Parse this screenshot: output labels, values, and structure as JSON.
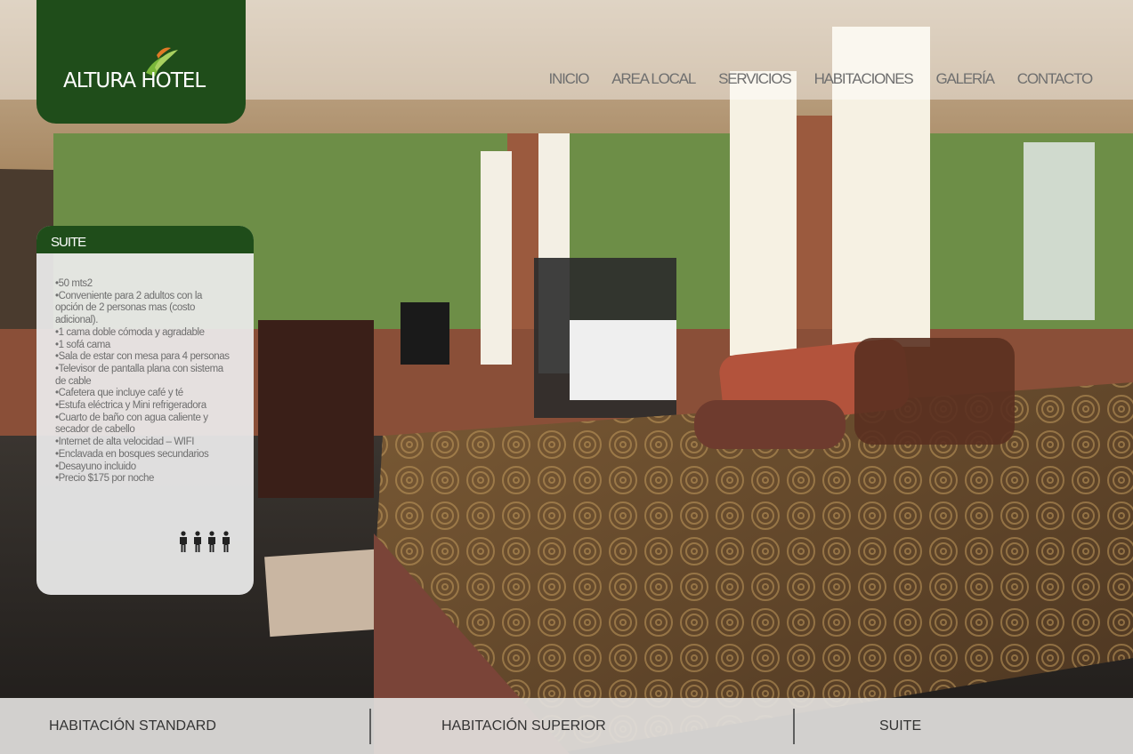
{
  "header": {
    "logo_text": "ALTURA HOTEL",
    "nav": [
      "INICIO",
      "AREA LOCAL",
      "SERVICIOS",
      "HABITACIONES",
      "GALERÍA",
      "CONTACTO"
    ]
  },
  "room_panel": {
    "title": "SUITE",
    "features": [
      "•50 mts2",
      "•Conveniente para 2 adultos con la opción de 2 personas mas (costo adicional).",
      "•1 cama doble cómoda y agradable",
      "•1 sofá cama",
      "•Sala de estar con mesa para 4 personas",
      "•Televisor de pantalla plana con sistema de cable",
      "•Cafetera que incluye café y té",
      "•Estufa eléctrica y Mini refrigeradora",
      "•Cuarto de baño con agua caliente y secador de cabello",
      "•Internet de alta velocidad – WIFI",
      "•Enclavada en bosques secundarios",
      "•Desayuno incluido",
      "•Precio $175 por noche"
    ],
    "occupancy_icons": [
      "person-icon",
      "person-icon",
      "person-icon",
      "person-icon"
    ]
  },
  "room_tabs": [
    "HABITACIÓN STANDARD",
    "HABITACIÓN SUPERIOR",
    "SUITE"
  ],
  "colors": {
    "brand_green": "#1f4d1a",
    "nav_text": "#6f6f6f"
  }
}
